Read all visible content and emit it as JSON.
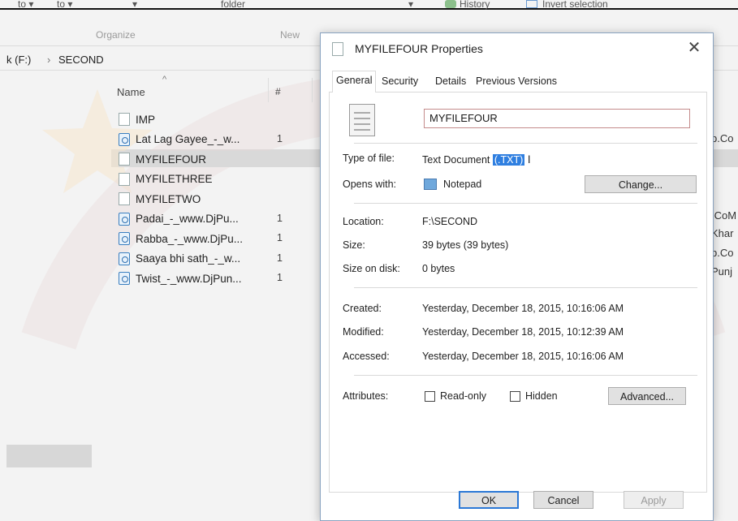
{
  "explorer": {
    "ribbon": {
      "frag1": "to ▾",
      "frag2": "to ▾",
      "frag3": "▾",
      "folder": "folder",
      "arrow": "▾",
      "history": "History",
      "invert_selection": "Invert selection"
    },
    "groups": {
      "organize": "Organize",
      "new": "New"
    },
    "breadcrumb": {
      "drive": "k (F:)",
      "separator": "›",
      "folder": "SECOND"
    },
    "columns": {
      "name": "Name",
      "number": "#"
    },
    "files": [
      {
        "name": "IMP",
        "type": "doc",
        "num": ""
      },
      {
        "name": "Lat Lag Gayee_-_w...",
        "type": "media",
        "num": "1"
      },
      {
        "name": "MYFILEFOUR",
        "type": "doc",
        "num": "",
        "selected": true
      },
      {
        "name": "MYFILETHREE",
        "type": "doc",
        "num": ""
      },
      {
        "name": "MYFILETWO",
        "type": "doc",
        "num": ""
      },
      {
        "name": "Padai_-_www.DjPu...",
        "type": "media",
        "num": "1"
      },
      {
        "name": "Rabba_-_www.DjPu...",
        "type": "media",
        "num": "1"
      },
      {
        "name": "Saaya bhi sath_-_w...",
        "type": "media",
        "num": "1"
      },
      {
        "name": "Twist_-_www.DjPun...",
        "type": "media",
        "num": "1"
      }
    ],
    "right_fragments": [
      "b.Co",
      ".CoM",
      "Khar",
      "b.Co",
      "Punj"
    ]
  },
  "dialog": {
    "title": "MYFILEFOUR Properties",
    "close": "✕",
    "tabs": [
      "General",
      "Security",
      "Details",
      "Previous Versions"
    ],
    "filename": "MYFILEFOUR",
    "type_label": "Type of file:",
    "type_value": "Text Document",
    "type_ext": "(.TXT)",
    "opens_label": "Opens with:",
    "opens_value": "Notepad",
    "change_button": "Change...",
    "location_label": "Location:",
    "location_value": "F:\\SECOND",
    "size_label": "Size:",
    "size_value": "39 bytes (39 bytes)",
    "size_on_disk_label": "Size on disk:",
    "size_on_disk_value": "0 bytes",
    "created_label": "Created:",
    "created_value": "Yesterday, December 18, 2015, 10:16:06 AM",
    "modified_label": "Modified:",
    "modified_value": "Yesterday, December 18, 2015, 10:12:39 AM",
    "accessed_label": "Accessed:",
    "accessed_value": "Yesterday, December 18, 2015, 10:16:06 AM",
    "attributes_label": "Attributes:",
    "readonly_label": "Read-only",
    "hidden_label": "Hidden",
    "advanced_button": "Advanced...",
    "ok_button": "OK",
    "cancel_button": "Cancel",
    "apply_button": "Apply"
  },
  "icons": {
    "title_icon": "document-icon",
    "file_icon": "text-file-icon",
    "notepad_icon": "notepad-icon",
    "history_icon": "history-icon",
    "invert_icon": "invert-selection-icon"
  },
  "colors": {
    "selection_highlight": "#2f7fe0",
    "default_button_border": "#2b78d6"
  }
}
